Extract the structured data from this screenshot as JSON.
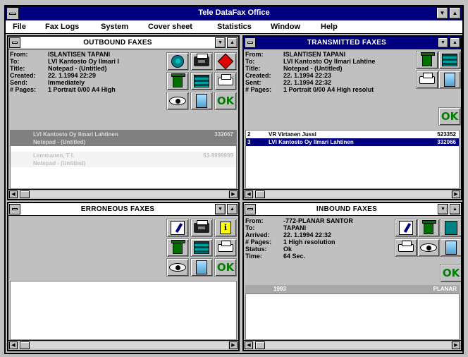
{
  "app": {
    "title": "Tele DataFax Office"
  },
  "menu": [
    "File",
    "Fax Logs",
    "System",
    "Cover sheet",
    "Statistics",
    "Window",
    "Help"
  ],
  "outbound": {
    "title": "OUTBOUND FAXES",
    "fields": [
      {
        "k": "From:",
        "v": "ISLANTISEN TAPANI"
      },
      {
        "k": "To:",
        "v": "LVI Kantosto Oy Ilmari I"
      },
      {
        "k": "Title:",
        "v": "Notepad - (Untitled)"
      },
      {
        "k": "Created:",
        "v": "22. 1.1994 22:29"
      },
      {
        "k": "Send:",
        "v": "Immediately"
      },
      {
        "k": "# Pages:",
        "v": "1 Portrait 0/00 A4 High"
      }
    ],
    "rows": [
      {
        "text": "LVI Kantosto Oy Ilmari Lahtinen",
        "num": "332067"
      },
      {
        "text": "Notepad - (Untitled)",
        "num": ""
      },
      {
        "text": "Lemmanen, T I.",
        "num": "51-9999999"
      },
      {
        "text": "Notepad - (Untitled)",
        "num": ""
      }
    ]
  },
  "transmitted": {
    "title": "TRANSMITTED FAXES",
    "fields": [
      {
        "k": "From:",
        "v": "ISLANTISEN TAPANI"
      },
      {
        "k": "To:",
        "v": "LVI Kantosto Oy Ilmari Lahtine"
      },
      {
        "k": "Title:",
        "v": "Notepad - (Untitled)"
      },
      {
        "k": "Created:",
        "v": "22. 1.1994 22:23"
      },
      {
        "k": "Sent:",
        "v": "22. 1.1994 22:32"
      },
      {
        "k": "# Pages:",
        "v": "1 Portrait 0/00 A4 High resolut"
      }
    ],
    "rows": [
      {
        "lead": "2",
        "text": "VR Virtanen Jussi",
        "num": "523352"
      },
      {
        "lead": "3",
        "text": "LVI Kantosto Oy Ilmari Lahtinen",
        "num": "332066"
      }
    ]
  },
  "erroneous": {
    "title": "ERRONEOUS FAXES"
  },
  "inbound": {
    "title": "INBOUND FAXES",
    "fields": [
      {
        "k": "From:",
        "v": "-772-PLANAR SANTOR"
      },
      {
        "k": "To:",
        "v": "TAPANI"
      },
      {
        "k": "Arrived:",
        "v": "22. 1.1994 22:32"
      },
      {
        "k": "# Pages:",
        "v": "1 High resolution"
      },
      {
        "k": "Status:",
        "v": "Ok"
      },
      {
        "k": "Time:",
        "v": "64 Sec."
      }
    ],
    "header": {
      "left": "1993",
      "right": "PLANAR"
    }
  },
  "labels": {
    "ok": "OK",
    "info": "i"
  },
  "colors": {
    "title_active": "#000080",
    "trash": "#007000",
    "stop": "#e00000",
    "ok": "#008000"
  }
}
